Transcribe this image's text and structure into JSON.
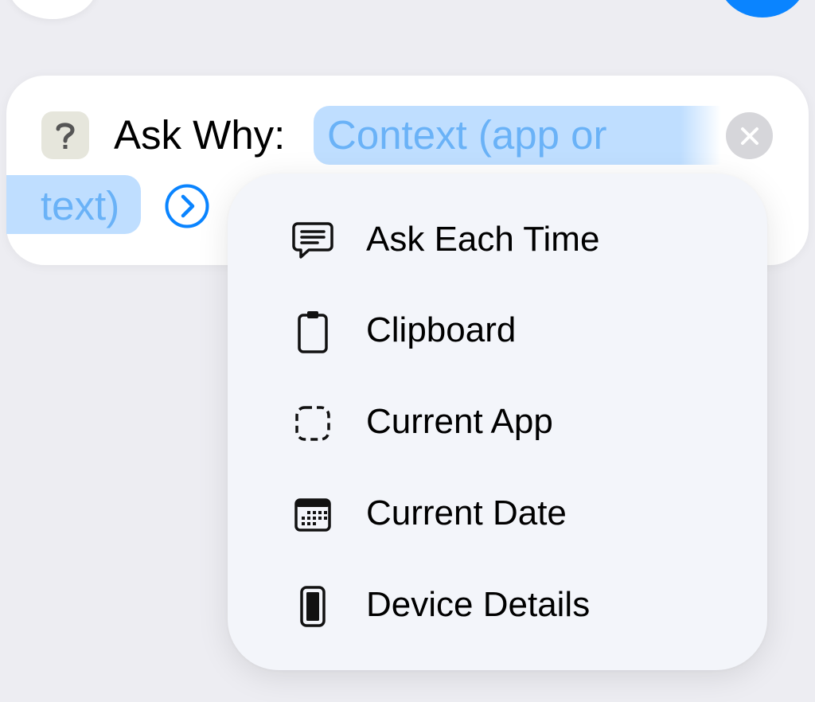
{
  "action": {
    "title": "Ask Why:",
    "icon": "question-mark-icon",
    "token_text_line1": "Context (app or",
    "token_text_line2": "text)",
    "expand_icon": "chevron-right-circle-icon",
    "clear_icon": "clear-x-icon"
  },
  "menu": {
    "items": [
      {
        "label": "Ask Each Time",
        "icon": "message-bubble-icon"
      },
      {
        "label": "Clipboard",
        "icon": "clipboard-icon"
      },
      {
        "label": "Current App",
        "icon": "dashed-square-icon"
      },
      {
        "label": "Current Date",
        "icon": "calendar-icon"
      },
      {
        "label": "Device Details",
        "icon": "phone-icon"
      }
    ]
  },
  "colors": {
    "background": "#ededf2",
    "accent": "#0a84ff",
    "token_fill": "#bfdeff",
    "token_text": "#6ab2f7"
  }
}
